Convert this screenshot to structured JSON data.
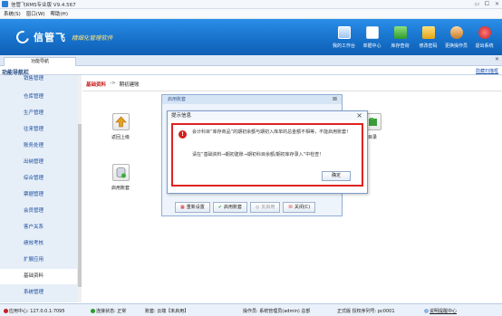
{
  "window": {
    "title": "信管飞RMS专业版 V9.4.567"
  },
  "menubar": {
    "items": [
      "系统(S)",
      "窗口(W)",
      "帮助(H)"
    ]
  },
  "banner": {
    "brand": "信管飞",
    "slogan": "精细化管理软件"
  },
  "toolbar": [
    "我的工作台",
    "单据中心",
    "库存查询",
    "修改密码",
    "更换操作员",
    "退出系统"
  ],
  "tabs": {
    "home": "功能导航"
  },
  "nav": {
    "title": "功能导航栏",
    "hide_link": "隐藏扫描框"
  },
  "sidebar": {
    "items": [
      "销售管理",
      "仓库管理",
      "生产管理",
      "往来管理",
      "账务处理",
      "出纳管理",
      "综合管理",
      "票据管理",
      "会员管理",
      "客户关系",
      "绩效考核",
      "扩展应用",
      "基础资料",
      "系统管理"
    ],
    "active": "基础资料"
  },
  "breadcrumb": {
    "section": "基础资料",
    "arrow": "->",
    "page": "期初建账"
  },
  "features": {
    "left_top": "返回上级",
    "left_bottom": "启用账套",
    "right": "目录"
  },
  "bg_window": {
    "title": "启用账套",
    "buttons": [
      "重新设置",
      "启用账套",
      "反启用",
      "关闭(C)"
    ]
  },
  "dialog": {
    "title": "提示信息",
    "message1": "会计科目“库存商品”的期初余额与期初入库单的总金额不相等，不能启用账套！",
    "message2": "请在“基础资料→期初建账→期初科目余额/期初库存录入”中检查！",
    "ok": "确定"
  },
  "statusbar": {
    "center": "应用中心: 127.0.0.1:7095",
    "conn": "连接状态: 正常",
    "account": "账套: 云端【未启用】",
    "operator": "操作员: 系统管理员(admin) 总部",
    "version": "正式版 授权序列号: pc0001",
    "mobile": "说明提醒中心"
  },
  "colors": {
    "banner": "#1670c9",
    "accent_red": "#e02020",
    "link": "#1a4fa0"
  }
}
